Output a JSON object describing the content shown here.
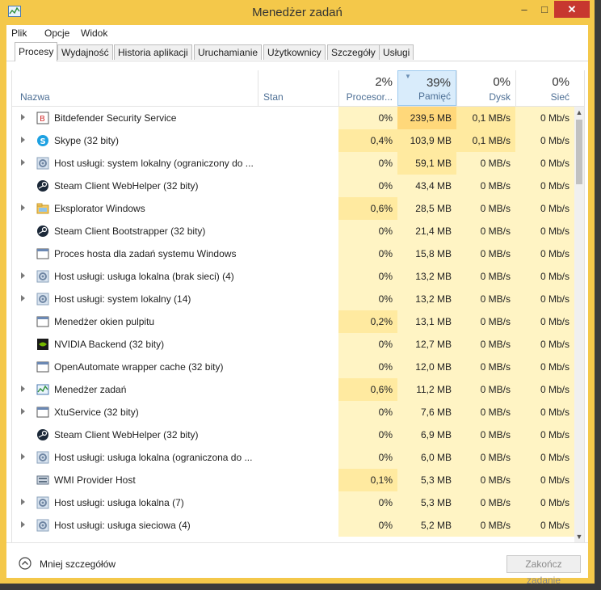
{
  "window": {
    "title": "Menedżer zadań"
  },
  "colors": {
    "frame": "#f4c84a",
    "close": "#c7372f",
    "heat_light": "#fff4c4",
    "heat_mid": "#ffeaa0",
    "heat_strong": "#ffd87a",
    "header_selected": "#d9ecfb"
  },
  "titlebar": {
    "minimize": "–",
    "maximize": "□",
    "close": "✕"
  },
  "menu": [
    "Plik",
    "Opcje",
    "Widok"
  ],
  "tabs": [
    "Procesy",
    "Wydajność",
    "Historia aplikacji",
    "Uruchamianie",
    "Użytkownicy",
    "Szczegóły",
    "Usługi"
  ],
  "header": {
    "name": "Nazwa",
    "status": "Stan",
    "cpu": {
      "pct": "2%",
      "label": "Procesor..."
    },
    "mem": {
      "pct": "39%",
      "label": "Pamięć"
    },
    "disk": {
      "pct": "0%",
      "label": "Dysk"
    },
    "net": {
      "pct": "0%",
      "label": "Sieć"
    }
  },
  "rows": [
    {
      "name": "Bitdefender Security Service",
      "expand": true,
      "icon": "bitdefender-icon",
      "cpu": "0%",
      "mem": "239,5 MB",
      "disk": "0,1 MB/s",
      "net": "0 Mb/s"
    },
    {
      "name": "Skype (32 bity)",
      "expand": true,
      "icon": "skype-icon",
      "cpu": "0,4%",
      "mem": "103,9 MB",
      "disk": "0,1 MB/s",
      "net": "0 Mb/s"
    },
    {
      "name": "Host usługi: system lokalny (ograniczony do ...",
      "expand": true,
      "icon": "gear-icon",
      "cpu": "0%",
      "mem": "59,1 MB",
      "disk": "0 MB/s",
      "net": "0 Mb/s"
    },
    {
      "name": "Steam Client WebHelper (32 bity)",
      "expand": false,
      "icon": "steam-icon",
      "cpu": "0%",
      "mem": "43,4 MB",
      "disk": "0 MB/s",
      "net": "0 Mb/s"
    },
    {
      "name": "Eksplorator Windows",
      "expand": true,
      "icon": "folder-icon",
      "cpu": "0,6%",
      "mem": "28,5 MB",
      "disk": "0 MB/s",
      "net": "0 Mb/s"
    },
    {
      "name": "Steam Client Bootstrapper (32 bity)",
      "expand": false,
      "icon": "steam-icon",
      "cpu": "0%",
      "mem": "21,4 MB",
      "disk": "0 MB/s",
      "net": "0 Mb/s"
    },
    {
      "name": "Proces hosta dla zadań systemu Windows",
      "expand": false,
      "icon": "window-icon",
      "cpu": "0%",
      "mem": "15,8 MB",
      "disk": "0 MB/s",
      "net": "0 Mb/s"
    },
    {
      "name": "Host usługi: usługa lokalna (brak sieci) (4)",
      "expand": true,
      "icon": "gear-icon",
      "cpu": "0%",
      "mem": "13,2 MB",
      "disk": "0 MB/s",
      "net": "0 Mb/s"
    },
    {
      "name": "Host usługi: system lokalny (14)",
      "expand": true,
      "icon": "gear-icon",
      "cpu": "0%",
      "mem": "13,2 MB",
      "disk": "0 MB/s",
      "net": "0 Mb/s"
    },
    {
      "name": "Menedżer okien pulpitu",
      "expand": false,
      "icon": "window-icon",
      "cpu": "0,2%",
      "mem": "13,1 MB",
      "disk": "0 MB/s",
      "net": "0 Mb/s"
    },
    {
      "name": "NVIDIA Backend (32 bity)",
      "expand": false,
      "icon": "nvidia-icon",
      "cpu": "0%",
      "mem": "12,7 MB",
      "disk": "0 MB/s",
      "net": "0 Mb/s"
    },
    {
      "name": "OpenAutomate wrapper cache (32 bity)",
      "expand": false,
      "icon": "window-icon",
      "cpu": "0%",
      "mem": "12,0 MB",
      "disk": "0 MB/s",
      "net": "0 Mb/s"
    },
    {
      "name": "Menedżer zadań",
      "expand": true,
      "icon": "task-manager-icon",
      "cpu": "0,6%",
      "mem": "11,2 MB",
      "disk": "0 MB/s",
      "net": "0 Mb/s"
    },
    {
      "name": "XtuService (32 bity)",
      "expand": true,
      "icon": "window-icon",
      "cpu": "0%",
      "mem": "7,6 MB",
      "disk": "0 MB/s",
      "net": "0 Mb/s"
    },
    {
      "name": "Steam Client WebHelper (32 bity)",
      "expand": false,
      "icon": "steam-icon",
      "cpu": "0%",
      "mem": "6,9 MB",
      "disk": "0 MB/s",
      "net": "0 Mb/s"
    },
    {
      "name": "Host usługi: usługa lokalna (ograniczona do ...",
      "expand": true,
      "icon": "gear-icon",
      "cpu": "0%",
      "mem": "6,0 MB",
      "disk": "0 MB/s",
      "net": "0 Mb/s"
    },
    {
      "name": "WMI Provider Host",
      "expand": false,
      "icon": "wmi-icon",
      "cpu": "0,1%",
      "mem": "5,3 MB",
      "disk": "0 MB/s",
      "net": "0 Mb/s"
    },
    {
      "name": "Host usługi: usługa lokalna (7)",
      "expand": true,
      "icon": "gear-icon",
      "cpu": "0%",
      "mem": "5,3 MB",
      "disk": "0 MB/s",
      "net": "0 Mb/s"
    },
    {
      "name": "Host usługi: usługa sieciowa (4)",
      "expand": true,
      "icon": "gear-icon",
      "cpu": "0%",
      "mem": "5,2 MB",
      "disk": "0 MB/s",
      "net": "0 Mb/s"
    }
  ],
  "footer": {
    "fewer_details": "Mniej szczegółów",
    "end_task": "Zakończ zadanie"
  }
}
